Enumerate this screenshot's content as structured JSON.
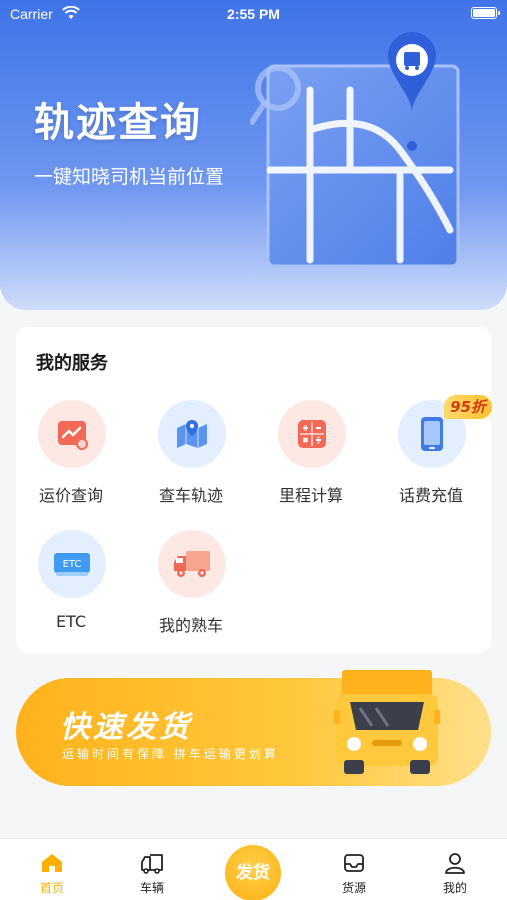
{
  "status_bar": {
    "carrier": "Carrier",
    "time": "2:55 PM"
  },
  "hero": {
    "title": "轨迹查询",
    "subtitle": "一键知晓司机当前位置"
  },
  "services": {
    "title": "我的服务",
    "items": [
      {
        "label": "运价查询",
        "icon": "price-chart-icon"
      },
      {
        "label": "查车轨迹",
        "icon": "map-pin-icon"
      },
      {
        "label": "里程计算",
        "icon": "calculator-icon"
      },
      {
        "label": "话费充值",
        "icon": "phone-icon",
        "badge": "95折"
      },
      {
        "label": "ETC",
        "icon": "etc-card-icon",
        "icon_text": "ETC"
      },
      {
        "label": "我的熟车",
        "icon": "truck-icon"
      }
    ]
  },
  "banner": {
    "title": "快速发货",
    "subtitle": "运输时间有保障   拼车运输更划算"
  },
  "tabbar": {
    "items": [
      {
        "label": "首页",
        "icon": "home-icon",
        "active": true
      },
      {
        "label": "车辆",
        "icon": "truck-icon"
      },
      {
        "label": "发货",
        "icon": "ship-button"
      },
      {
        "label": "货源",
        "icon": "inbox-icon"
      },
      {
        "label": "我的",
        "icon": "user-icon"
      }
    ]
  },
  "colors": {
    "accent": "#ffb000",
    "hero_blue": "#3f74e8",
    "badge_text": "#d23b14"
  }
}
